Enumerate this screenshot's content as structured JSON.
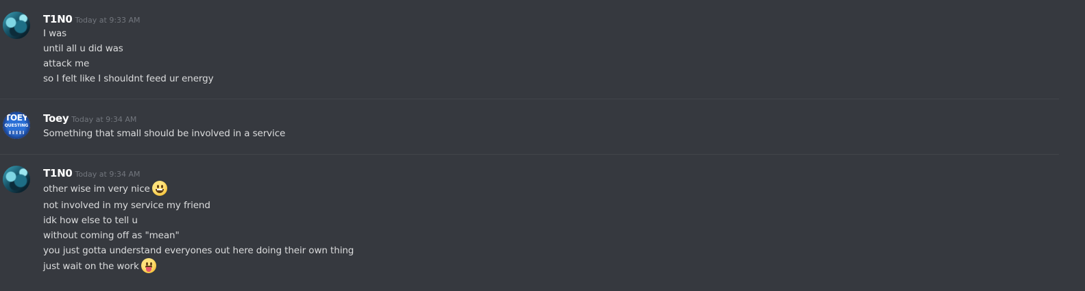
{
  "messages": [
    {
      "author": "T1N0",
      "timestamp": "Today at 9:33 AM",
      "avatar": "tino-avatar",
      "lines": [
        "I was",
        "until all u did was",
        "attack me",
        "so I felt like I shouldnt feed ur energy"
      ]
    },
    {
      "author": "Toey",
      "timestamp": "Today at 9:34 AM",
      "avatar": "toey-avatar",
      "avatar_text_top": "TOEY",
      "avatar_text_bottom": "QUESTING",
      "lines": [
        "Something that small should be involved in a service"
      ]
    },
    {
      "author": "T1N0",
      "timestamp": "Today at 9:34 AM",
      "avatar": "tino-avatar",
      "lines": [
        "other wise im very nice",
        "not involved in my service my friend",
        "idk how else to tell u",
        "without coming off as \"mean\"",
        "you just gotta understand everyones out here doing their own thing",
        "just wait on the work"
      ],
      "emojis": [
        "smiley-emoji",
        "tongue-out-emoji"
      ]
    }
  ],
  "colors": {
    "background": "#36393f",
    "username": "#ffffff",
    "text": "#dcddde",
    "timestamp": "#72767d",
    "divider": "#42454a"
  }
}
